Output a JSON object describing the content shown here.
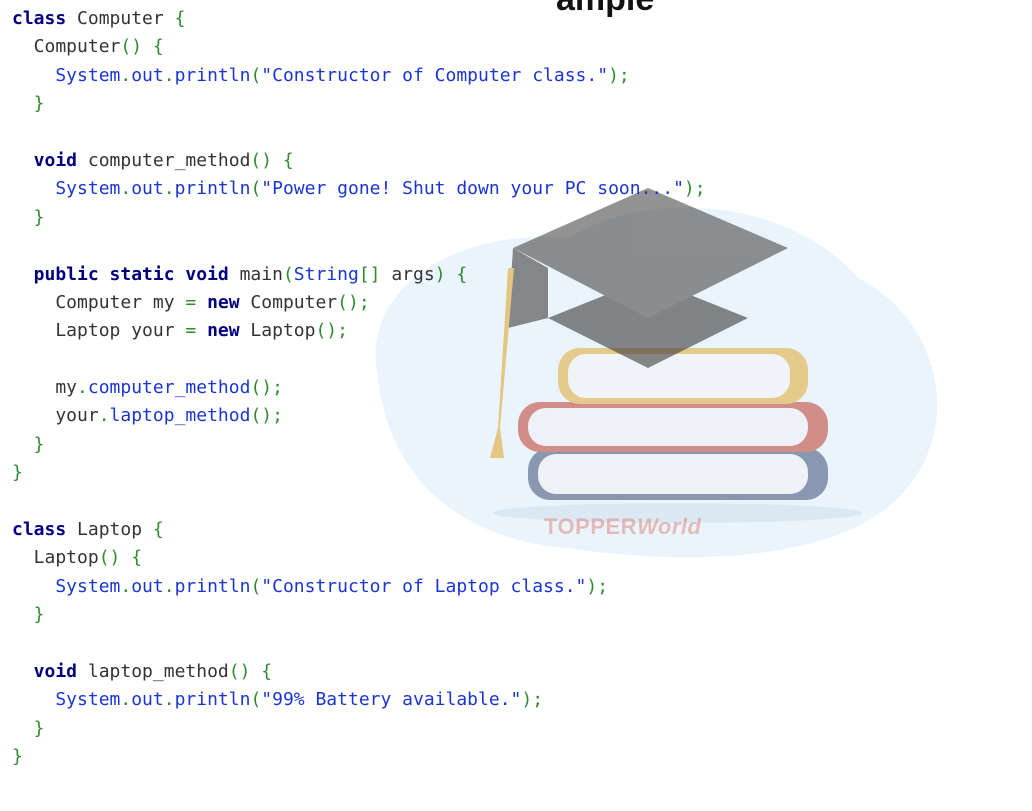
{
  "heading_fragment": "ample",
  "watermark": {
    "brand_prefix": "TOPPER",
    "brand_suffix": "World",
    "icon": "graduation-cap-books-icon"
  },
  "colors": {
    "keyword": "#000080",
    "identifier": "#333333",
    "punctuation": "#2e8b2e",
    "string": "#1a35d6"
  },
  "code": {
    "lines": [
      [
        [
          "kw",
          "class"
        ],
        [
          "id",
          " Computer "
        ],
        [
          "pn",
          "{"
        ]
      ],
      [
        [
          "id",
          "  Computer"
        ],
        [
          "pn",
          "() {"
        ]
      ],
      [
        [
          "st",
          "    System"
        ],
        [
          "pn",
          "."
        ],
        [
          "st",
          "out"
        ],
        [
          "pn",
          "."
        ],
        [
          "st",
          "println"
        ],
        [
          "pn",
          "("
        ],
        [
          "st",
          "\"Constructor of Computer class.\""
        ],
        [
          "pn",
          ");"
        ]
      ],
      [
        [
          "pn",
          "  }"
        ]
      ],
      [],
      [
        [
          "kw",
          "  void"
        ],
        [
          "id",
          " computer_method"
        ],
        [
          "pn",
          "() {"
        ]
      ],
      [
        [
          "st",
          "    System"
        ],
        [
          "pn",
          "."
        ],
        [
          "st",
          "out"
        ],
        [
          "pn",
          "."
        ],
        [
          "st",
          "println"
        ],
        [
          "pn",
          "("
        ],
        [
          "st",
          "\"Power gone! Shut down your PC soon...\""
        ],
        [
          "pn",
          ");"
        ]
      ],
      [
        [
          "pn",
          "  }"
        ]
      ],
      [],
      [
        [
          "kw",
          "  public static void"
        ],
        [
          "id",
          " main"
        ],
        [
          "pn",
          "("
        ],
        [
          "st",
          "String"
        ],
        [
          "pn",
          "[]"
        ],
        [
          "id",
          " args"
        ],
        [
          "pn",
          ") {"
        ]
      ],
      [
        [
          "id",
          "    Computer my "
        ],
        [
          "pn",
          "="
        ],
        [
          "kw",
          " new"
        ],
        [
          "id",
          " Computer"
        ],
        [
          "pn",
          "();"
        ]
      ],
      [
        [
          "id",
          "    Laptop your "
        ],
        [
          "pn",
          "="
        ],
        [
          "kw",
          " new"
        ],
        [
          "id",
          " Laptop"
        ],
        [
          "pn",
          "();"
        ]
      ],
      [],
      [
        [
          "id",
          "    my"
        ],
        [
          "pn",
          "."
        ],
        [
          "st",
          "computer_method"
        ],
        [
          "pn",
          "();"
        ]
      ],
      [
        [
          "id",
          "    your"
        ],
        [
          "pn",
          "."
        ],
        [
          "st",
          "laptop_method"
        ],
        [
          "pn",
          "();"
        ]
      ],
      [
        [
          "pn",
          "  }"
        ]
      ],
      [
        [
          "pn",
          "}"
        ]
      ],
      [],
      [
        [
          "kw",
          "class"
        ],
        [
          "id",
          " Laptop "
        ],
        [
          "pn",
          "{"
        ]
      ],
      [
        [
          "id",
          "  Laptop"
        ],
        [
          "pn",
          "() {"
        ]
      ],
      [
        [
          "st",
          "    System"
        ],
        [
          "pn",
          "."
        ],
        [
          "st",
          "out"
        ],
        [
          "pn",
          "."
        ],
        [
          "st",
          "println"
        ],
        [
          "pn",
          "("
        ],
        [
          "st",
          "\"Constructor of Laptop class.\""
        ],
        [
          "pn",
          ");"
        ]
      ],
      [
        [
          "pn",
          "  }"
        ]
      ],
      [],
      [
        [
          "kw",
          "  void"
        ],
        [
          "id",
          " laptop_method"
        ],
        [
          "pn",
          "() {"
        ]
      ],
      [
        [
          "st",
          "    System"
        ],
        [
          "pn",
          "."
        ],
        [
          "st",
          "out"
        ],
        [
          "pn",
          "."
        ],
        [
          "st",
          "println"
        ],
        [
          "pn",
          "("
        ],
        [
          "st",
          "\"99% Battery available.\""
        ],
        [
          "pn",
          ");"
        ]
      ],
      [
        [
          "pn",
          "  }"
        ]
      ],
      [
        [
          "pn",
          "}"
        ]
      ]
    ]
  }
}
